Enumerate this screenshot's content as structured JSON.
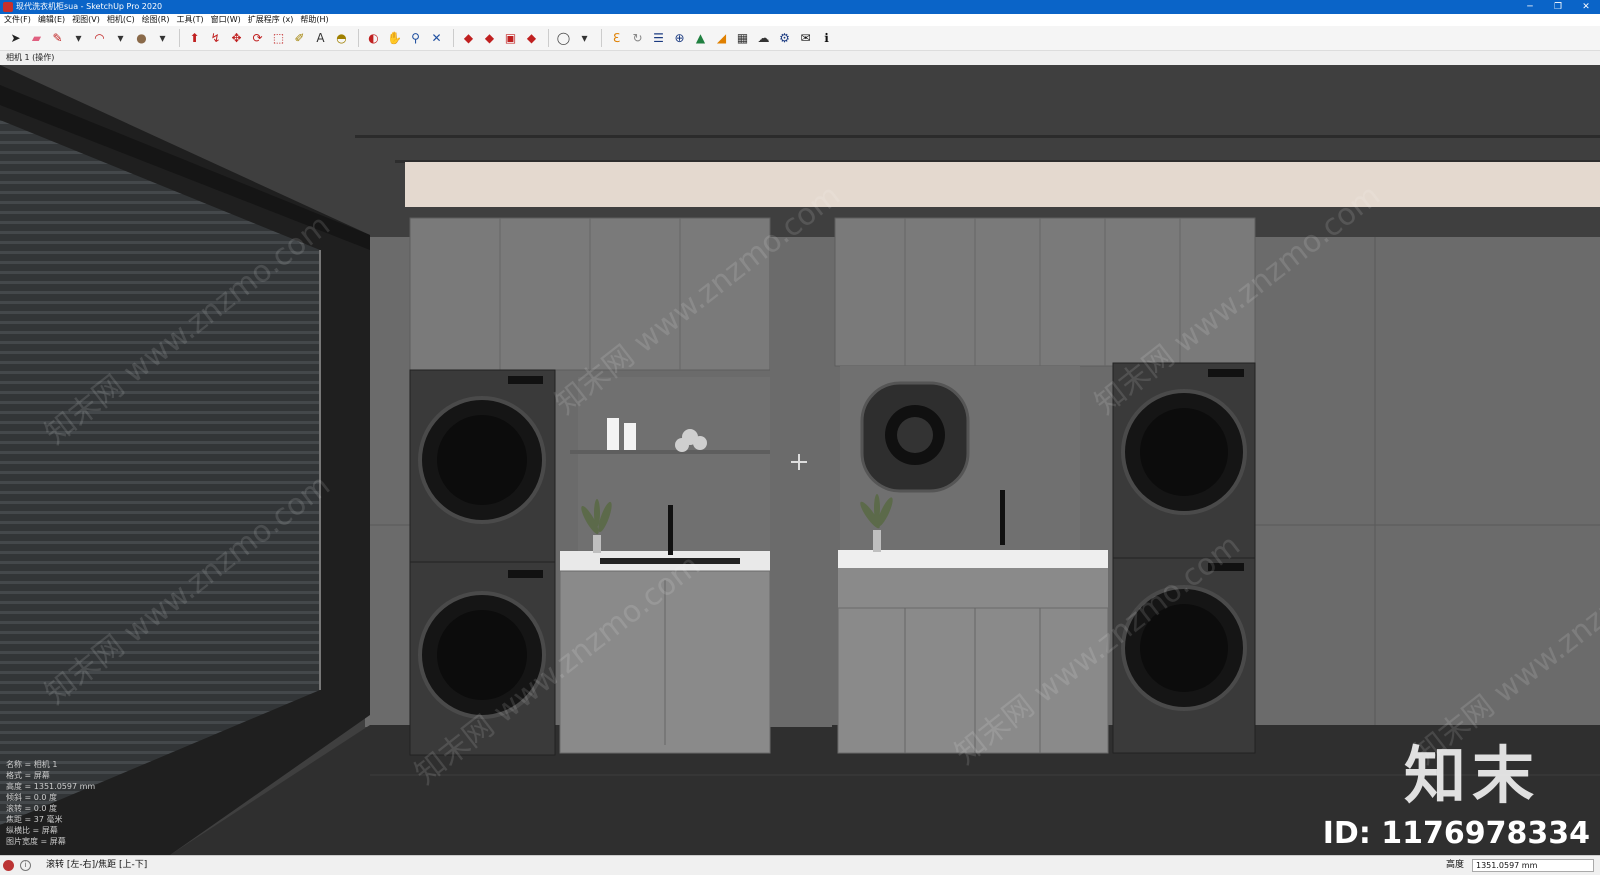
{
  "window": {
    "title": "现代洗衣机柜sua - SketchUp Pro 2020",
    "controls": [
      "─",
      "❐",
      "✕"
    ]
  },
  "menu": [
    "文件(F)",
    "编辑(E)",
    "视图(V)",
    "相机(C)",
    "绘图(R)",
    "工具(T)",
    "窗口(W)",
    "扩展程序 (x)",
    "帮助(H)"
  ],
  "toolbar": {
    "groups": [
      [
        {
          "icon": "select-icon",
          "glyph": "➤",
          "color": "#222"
        },
        {
          "icon": "eraser-icon",
          "glyph": "▰",
          "color": "#e06080"
        },
        {
          "icon": "pencil-icon",
          "glyph": "✎",
          "color": "#c02020"
        },
        {
          "icon": "dropdown-icon",
          "glyph": "▾",
          "color": "#333"
        },
        {
          "icon": "arc-icon",
          "glyph": "◠",
          "color": "#c02020"
        },
        {
          "icon": "dropdown-icon",
          "glyph": "▾",
          "color": "#333"
        },
        {
          "icon": "circle-icon",
          "glyph": "●",
          "color": "#8a6a4a"
        },
        {
          "icon": "dropdown-icon",
          "glyph": "▾",
          "color": "#333"
        }
      ],
      [
        {
          "icon": "push-pull-icon",
          "glyph": "⬆",
          "color": "#c02020"
        },
        {
          "icon": "follow-me-icon",
          "glyph": "↯",
          "color": "#c02020"
        },
        {
          "icon": "move-icon",
          "glyph": "✥",
          "color": "#c02020"
        },
        {
          "icon": "rotate-icon",
          "glyph": "⟳",
          "color": "#c02020"
        },
        {
          "icon": "scale-icon",
          "glyph": "⬚",
          "color": "#c02020"
        },
        {
          "icon": "tape-measure-icon",
          "glyph": "✐",
          "color": "#a08000"
        },
        {
          "icon": "text-icon",
          "glyph": "A",
          "color": "#333"
        },
        {
          "icon": "paint-bucket-icon",
          "glyph": "◓",
          "color": "#a08000"
        }
      ],
      [
        {
          "icon": "orbit-icon",
          "glyph": "◐",
          "color": "#c02020"
        },
        {
          "icon": "pan-icon",
          "glyph": "✋",
          "color": "#a07030"
        },
        {
          "icon": "zoom-icon",
          "glyph": "⚲",
          "color": "#2050a0"
        },
        {
          "icon": "zoom-extents-icon",
          "glyph": "✕",
          "color": "#2050a0"
        }
      ],
      [
        {
          "icon": "warehouse-icon",
          "glyph": "◆",
          "color": "#c02020"
        },
        {
          "icon": "extension-warehouse-icon",
          "glyph": "◆",
          "color": "#c02020"
        },
        {
          "icon": "layout-icon",
          "glyph": "▣",
          "color": "#c02020"
        },
        {
          "icon": "extension-manager-icon",
          "glyph": "◆",
          "color": "#c02020"
        }
      ],
      [
        {
          "icon": "account-icon",
          "glyph": "◯",
          "color": "#444"
        },
        {
          "icon": "dropdown-icon",
          "glyph": "▾",
          "color": "#333"
        }
      ],
      [
        {
          "icon": "plugin-e-icon",
          "glyph": "ℇ",
          "color": "#e08000"
        },
        {
          "icon": "refresh-icon",
          "glyph": "↻",
          "color": "#888"
        },
        {
          "icon": "plugin-list-icon",
          "glyph": "☰",
          "color": "#1a3a80"
        },
        {
          "icon": "add-icon",
          "glyph": "⊕",
          "color": "#1a3a80"
        },
        {
          "icon": "tree-icon",
          "glyph": "▲",
          "color": "#208040"
        },
        {
          "icon": "terrain-icon",
          "glyph": "◢",
          "color": "#e08000"
        },
        {
          "icon": "checker-icon",
          "glyph": "▦",
          "color": "#333"
        },
        {
          "icon": "cloud-upload-icon",
          "glyph": "☁",
          "color": "#333"
        },
        {
          "icon": "settings-icon",
          "glyph": "⚙",
          "color": "#1a3a80"
        },
        {
          "icon": "mail-icon",
          "glyph": "✉",
          "color": "#111"
        },
        {
          "icon": "info-icon",
          "glyph": "ℹ",
          "color": "#111"
        }
      ]
    ]
  },
  "scene": {
    "tab_label": "相机 1 (操作)"
  },
  "viewport_info": [
    "名称 = 相机 1",
    "格式 = 屏幕",
    "高度 = 1351.0597 mm",
    "倾斜 = 0.0 度",
    "滚转 = 0.0 度",
    "焦距 = 37 毫米",
    "纵横比 = 屏幕",
    "图片宽度 = 屏幕"
  ],
  "watermark": {
    "text": "知末网 www.znzmo.com",
    "brand": "知末",
    "id": "ID: 1176978334"
  },
  "status": {
    "hint": "滚转 [左-右]/焦距 [上-下]",
    "measure_label": "高度",
    "measure_value": "1351.0597 mm"
  }
}
